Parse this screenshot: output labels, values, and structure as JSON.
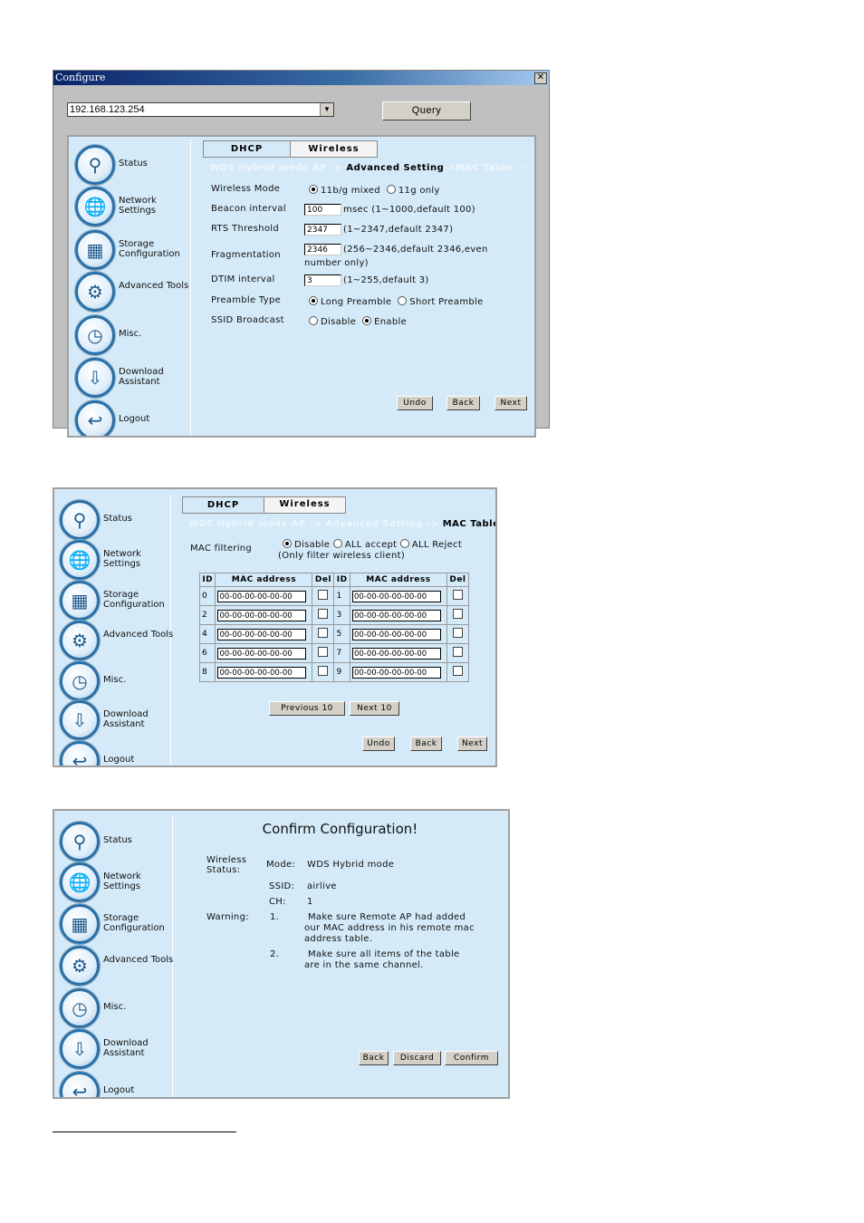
{
  "sidebar": {
    "items": [
      {
        "label": "Status",
        "icon": "magnifier-icon",
        "glyph": "⚲"
      },
      {
        "label": "Network Settings",
        "icon": "network-globe-icon",
        "glyph": "🌐"
      },
      {
        "label": "Storage Configuration",
        "icon": "storage-grid-icon",
        "glyph": "▦"
      },
      {
        "label": "Advanced Tools",
        "icon": "gears-icon",
        "glyph": "⚙"
      },
      {
        "label": "Misc.",
        "icon": "clock-icon",
        "glyph": "◷"
      },
      {
        "label": "Download Assistant",
        "icon": "download-icon",
        "glyph": "⇩"
      },
      {
        "label": "Logout",
        "icon": "logout-arrow-icon",
        "glyph": "↩"
      }
    ]
  },
  "shot1": {
    "window_title": "Configure",
    "ip_value": "192.168.123.254",
    "query_label": "Query",
    "tabs": [
      "DHCP",
      "Wireless"
    ],
    "crumb": {
      "a": "WDS Hybrid mode AP ->",
      "b": "Advanced Setting",
      "c": ">MAC Table —"
    },
    "wireless_mode": {
      "label": "Wireless Mode",
      "opt1": "11b/g mixed",
      "opt2": "11g only",
      "selected": "11b/g mixed"
    },
    "beacon": {
      "label": "Beacon interval",
      "value": "100",
      "hint": "msec (1~1000,default 100)"
    },
    "rts": {
      "label": "RTS Threshold",
      "value": "2347",
      "hint": "(1~2347,default 2347)"
    },
    "frag": {
      "label": "Fragmentation",
      "value": "2346",
      "hint": "(256~2346,default 2346,even",
      "hint2": "number only)"
    },
    "dtim": {
      "label": "DTIM interval",
      "value": "3",
      "hint": "(1~255,default 3)"
    },
    "preamble": {
      "label": "Preamble Type",
      "opt1": "Long Preamble",
      "opt2": "Short Preamble",
      "selected": "Long Preamble"
    },
    "ssid": {
      "label": "SSID Broadcast",
      "opt1": "Disable",
      "opt2": "Enable",
      "selected": "Enable"
    },
    "buttons": {
      "undo": "Undo",
      "back": "Back",
      "next": "Next"
    }
  },
  "shot2": {
    "tabs": [
      "DHCP",
      "Wireless"
    ],
    "crumb": {
      "a": "WDS Hybrid mode AP ->",
      "b": "Advanced Setting ->",
      "c": "MAC Table —"
    },
    "mac_filter": {
      "label": "MAC filtering",
      "opt1": "Disable",
      "opt2": "ALL accept",
      "opt3": "ALL Reject",
      "selected": "Disable",
      "note": "(Only filter wireless client)"
    },
    "table": {
      "headers": [
        "ID",
        "MAC address",
        "Del",
        "ID",
        "MAC address",
        "Del"
      ],
      "rows": [
        [
          {
            "id": "0",
            "mac": "00-00-00-00-00-00"
          },
          {
            "id": "1",
            "mac": "00-00-00-00-00-00"
          }
        ],
        [
          {
            "id": "2",
            "mac": "00-00-00-00-00-00"
          },
          {
            "id": "3",
            "mac": "00-00-00-00-00-00"
          }
        ],
        [
          {
            "id": "4",
            "mac": "00-00-00-00-00-00"
          },
          {
            "id": "5",
            "mac": "00-00-00-00-00-00"
          }
        ],
        [
          {
            "id": "6",
            "mac": "00-00-00-00-00-00"
          },
          {
            "id": "7",
            "mac": "00-00-00-00-00-00"
          }
        ],
        [
          {
            "id": "8",
            "mac": "00-00-00-00-00-00"
          },
          {
            "id": "9",
            "mac": "00-00-00-00-00-00"
          }
        ]
      ]
    },
    "prev10": "Previous 10",
    "next10": "Next 10",
    "buttons": {
      "undo": "Undo",
      "back": "Back",
      "next": "Next"
    }
  },
  "shot3": {
    "title": "Confirm Configuration!",
    "status_label": "Wireless Status:",
    "mode_label": "Mode:",
    "mode_value": "WDS Hybrid mode",
    "ssid_label": "SSID:",
    "ssid_value": "airlive",
    "ch_label": "CH:",
    "ch_value": "1",
    "warning_label": "Warning:",
    "w1_num": "1.",
    "w1_text": "Make sure Remote AP had added our MAC address in his remote mac address table.",
    "w2_num": "2.",
    "w2_text": "Make sure all items of the table are in the same channel.",
    "buttons": {
      "back": "Back",
      "discard": "Discard",
      "confirm": "Confirm"
    }
  }
}
